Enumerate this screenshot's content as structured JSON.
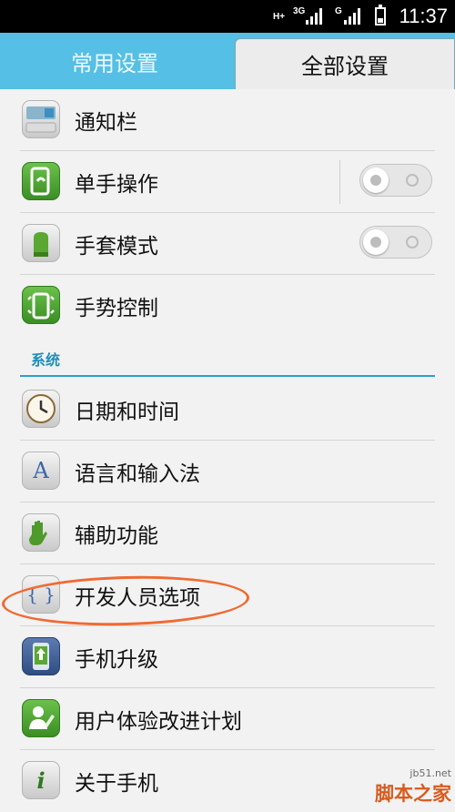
{
  "status_bar": {
    "network1": "H+",
    "network2": "3G",
    "network3": "G",
    "time": "11:37"
  },
  "tabs": {
    "common": "常用设置",
    "all": "全部设置"
  },
  "rows_top": [
    {
      "label": "通知栏",
      "icon": "notification-bar-icon"
    },
    {
      "label": "单手操作",
      "icon": "one-hand-icon",
      "toggle": false
    },
    {
      "label": "手套模式",
      "icon": "glove-icon",
      "toggle": false
    },
    {
      "label": "手势控制",
      "icon": "gesture-icon"
    }
  ],
  "section": {
    "title": "系统"
  },
  "rows_system": [
    {
      "label": "日期和时间",
      "icon": "clock-icon"
    },
    {
      "label": "语言和输入法",
      "icon": "language-icon",
      "glyph": "A"
    },
    {
      "label": "辅助功能",
      "icon": "accessibility-hand-icon"
    },
    {
      "label": "开发人员选项",
      "icon": "developer-braces-icon",
      "glyph": "{ }"
    },
    {
      "label": "手机升级",
      "icon": "phone-upgrade-icon"
    },
    {
      "label": "用户体验改进计划",
      "icon": "user-experience-icon"
    },
    {
      "label": "关于手机",
      "icon": "about-info-icon",
      "glyph": "i"
    }
  ],
  "watermark": {
    "site": "jb51.net",
    "name": "脚本之家"
  },
  "colors": {
    "tab_bar": "#55bfe5",
    "section_accent": "#2aa0d0",
    "highlight_circle": "#f06a32"
  }
}
